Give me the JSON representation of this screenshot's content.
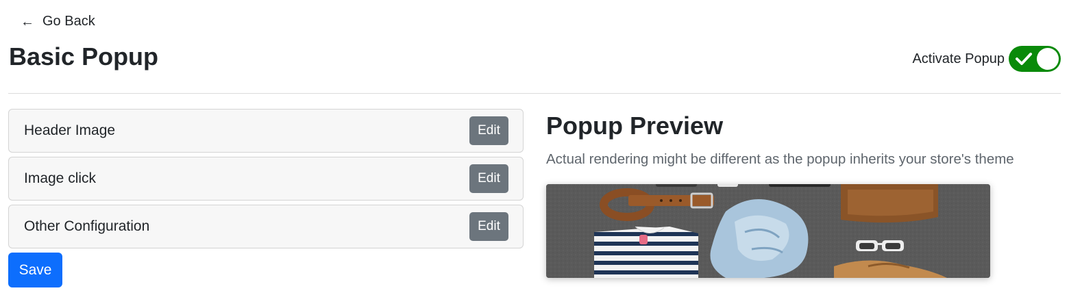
{
  "nav": {
    "back_label": "Go Back"
  },
  "header": {
    "title": "Basic Popup",
    "activate_label": "Activate Popup",
    "activate_on": true
  },
  "sections": [
    {
      "label": "Header Image",
      "edit_label": "Edit"
    },
    {
      "label": "Image click",
      "edit_label": "Edit"
    },
    {
      "label": "Other Configuration",
      "edit_label": "Edit"
    }
  ],
  "actions": {
    "save_label": "Save"
  },
  "preview": {
    "title": "Popup Preview",
    "note": "Actual rendering might be different as the popup inherits your store's theme"
  },
  "colors": {
    "toggle_on": "#0a8a0a",
    "primary": "#0d6efd",
    "secondary": "#6c757d"
  }
}
